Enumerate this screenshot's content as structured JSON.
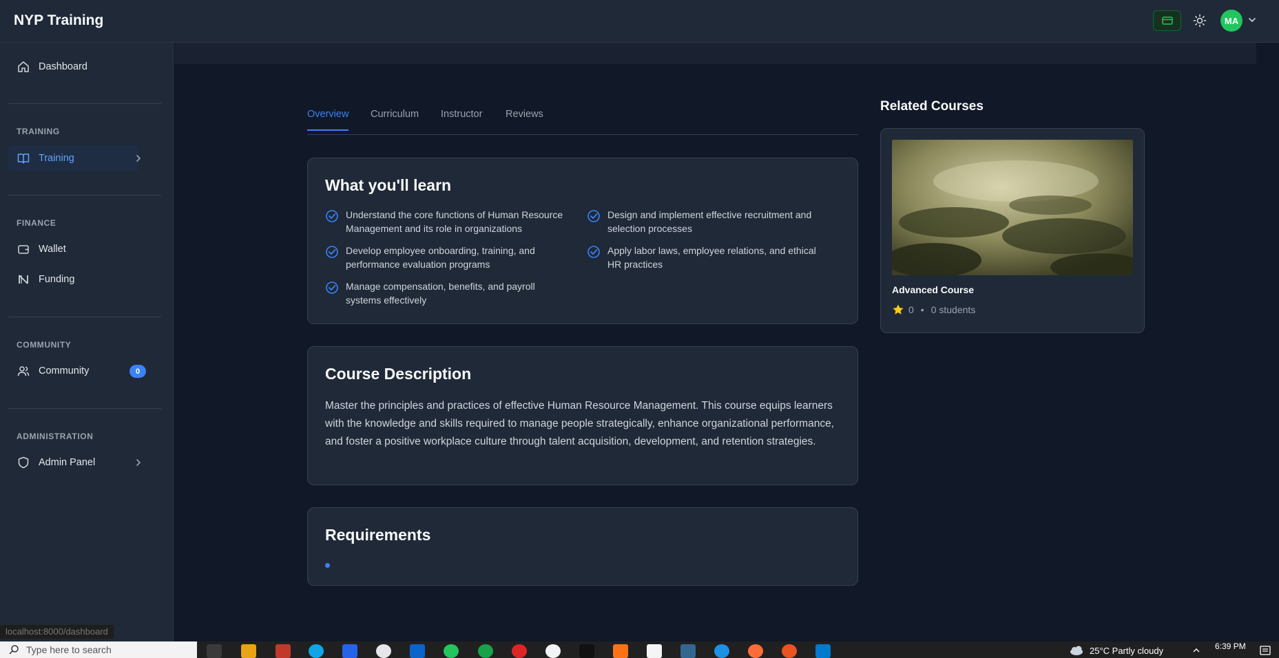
{
  "app": {
    "title": "NYP Training"
  },
  "header": {
    "avatar_initials": "MA"
  },
  "sidebar": {
    "dashboard": "Dashboard",
    "sections": {
      "training": "TRAINING",
      "finance": "FINANCE",
      "community": "COMMUNITY",
      "administration": "ADMINISTRATION"
    },
    "items": {
      "training": "Training",
      "wallet": "Wallet",
      "funding": "Funding",
      "community": "Community",
      "community_badge": "0",
      "admin_panel": "Admin Panel"
    }
  },
  "tabs": [
    "Overview",
    "Curriculum",
    "Instructor",
    "Reviews"
  ],
  "learn": {
    "title": "What you'll learn",
    "items": [
      "Understand the core functions of Human Resource Management and its role in organizations",
      "Design and implement effective recruitment and selection processes",
      "Develop employee onboarding, training, and performance evaluation programs",
      "Apply labor laws, employee relations, and ethical HR practices",
      "Manage compensation, benefits, and payroll systems effectively"
    ]
  },
  "description": {
    "title": "Course Description",
    "text": "Master the principles and practices of effective Human Resource Management. This course equips learners with the knowledge and skills required to manage people strategically, enhance organizational performance, and foster a positive workplace culture through talent acquisition, development, and retention strategies."
  },
  "requirements": {
    "title": "Requirements"
  },
  "related": {
    "title": "Related Courses",
    "course": {
      "name": "Advanced Course",
      "rating": "0",
      "students": "0 students"
    }
  },
  "status_url": "localhost:8000/dashboard",
  "taskbar": {
    "search_placeholder": "Type here to search",
    "weather": "25°C  Partly cloudy",
    "time": "6:39 PM"
  },
  "colors": {
    "accent": "#3b82f6",
    "avatar": "#22c55e",
    "background": "#111827",
    "surface": "#1f2937"
  }
}
